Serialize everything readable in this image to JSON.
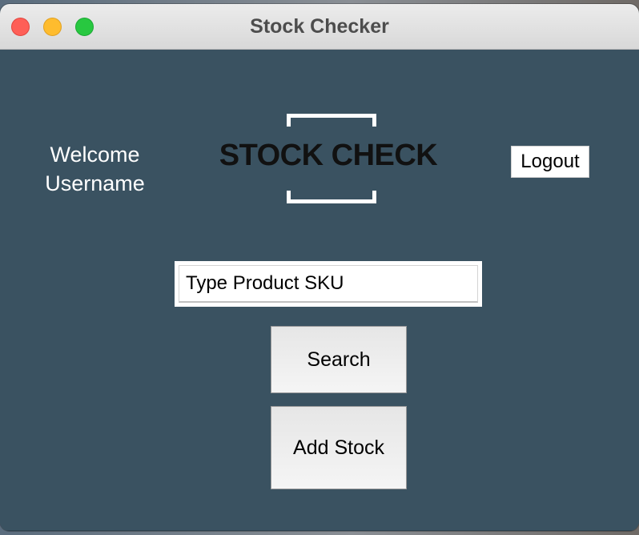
{
  "window": {
    "title": "Stock Checker"
  },
  "header": {
    "welcome_line1": "Welcome",
    "welcome_line2": "Username",
    "logo_text": "STOCK CHECK",
    "logout_label": "Logout"
  },
  "search": {
    "placeholder": "Type Product SKU",
    "value": ""
  },
  "actions": {
    "search_label": "Search",
    "add_stock_label": "Add Stock"
  },
  "colors": {
    "background": "#3a5261",
    "titlebar": "#e2e2e2",
    "close": "#fe5f57",
    "minimize": "#febc2e",
    "maximize": "#28c840"
  }
}
